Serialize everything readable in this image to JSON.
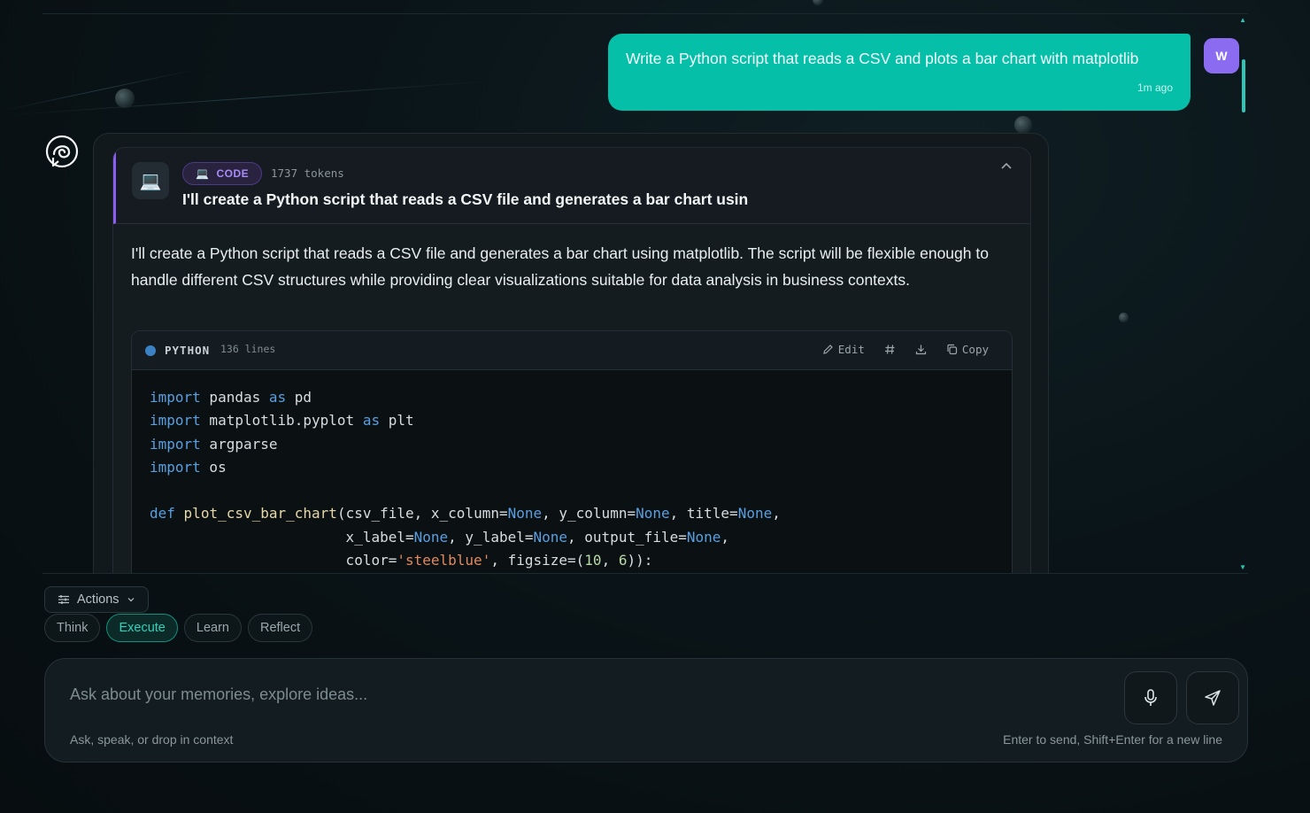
{
  "chat": {
    "user_message": {
      "text": "Write a Python script that reads a CSV and plots a bar chart with matplotlib",
      "time": "1m ago",
      "avatar_initial": "W"
    },
    "assistant": {
      "badge_label": "CODE",
      "tokens": "1737 tokens",
      "title": "I'll create a Python script that reads a CSV file and generates a bar chart usin",
      "body": "I'll create a Python script that reads a CSV file and generates a bar chart using matplotlib. The script will be flexible enough to handle different CSV structures while providing clear visualizations suitable for data analysis in business contexts.",
      "code": {
        "language": "PYTHON",
        "lines": "136 lines",
        "edit_label": "Edit",
        "copy_label": "Copy"
      }
    }
  },
  "controls": {
    "actions_label": "Actions",
    "modes": [
      "Think",
      "Execute",
      "Learn",
      "Reflect"
    ],
    "active_mode": "Execute"
  },
  "composer": {
    "placeholder": "Ask about your memories, explore ideas...",
    "hint_left": "Ask, speak, or drop in context",
    "hint_right": "Enter to send, Shift+Enter for a new line"
  },
  "colors": {
    "accent": "#06bfa8",
    "user_avatar": "#8b6cf0",
    "code_badge": "#a78bfa"
  },
  "icons": [
    "assistant-logo-icon",
    "laptop-icon",
    "chevron-up-icon",
    "pencil-icon",
    "hash-icon",
    "download-icon",
    "copy-icon",
    "sliders-icon",
    "chevron-down-icon",
    "microphone-icon",
    "send-icon"
  ]
}
